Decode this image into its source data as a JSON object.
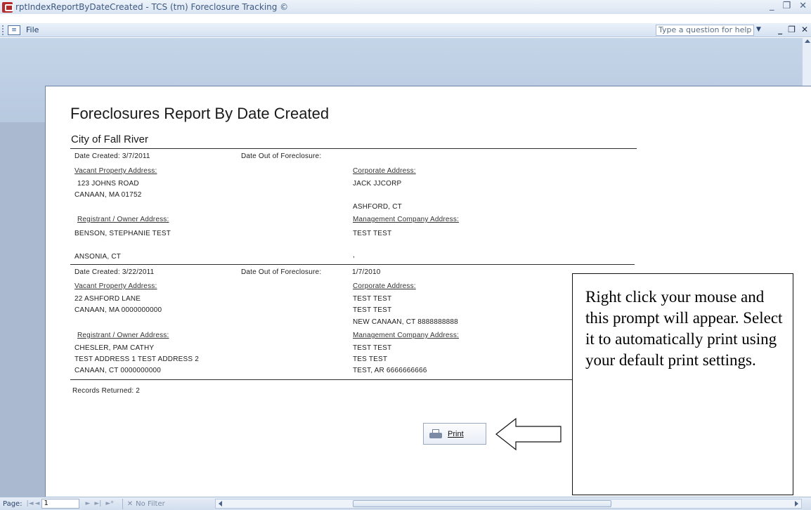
{
  "window": {
    "title": "rptIndexReportByDateCreated - TCS (tm) Foreclosure Tracking ©",
    "min": "_",
    "restore": "❐",
    "close": "✕"
  },
  "menubar": {
    "file": "File",
    "help_placeholder": "Type a question for help",
    "mdi_min": "_",
    "mdi_restore": "❐",
    "mdi_close": "✕"
  },
  "report": {
    "title": "Foreclosures Report By Date Created",
    "city": "City of Fall River",
    "records": [
      {
        "date_created": "Date Created:  3/7/2011",
        "date_out": "Date Out of Foreclosure:",
        "date_out_value": "",
        "vacant_label": "Vacant Property Address:",
        "vacant": [
          "123 JOHNS ROAD",
          "CANAAN, MA 01752"
        ],
        "corporate_label": "Corporate Address:",
        "corporate": [
          "JACK JJCORP",
          "",
          "ASHFORD, CT"
        ],
        "registrant_label": "Registrant / Owner Address:",
        "registrant": [
          "BENSON, STEPHANIE TEST",
          "",
          "ANSONIA, CT"
        ],
        "management_label": "Management Company Address:",
        "management": [
          "TEST TEST",
          "",
          ","
        ]
      },
      {
        "date_created": "Date Created:  3/22/2011",
        "date_out": "Date Out of Foreclosure:",
        "date_out_value": "1/7/2010",
        "vacant_label": "Vacant Property Address:",
        "vacant": [
          "22 ASHFORD LANE",
          "CANAAN, MA 0000000000"
        ],
        "corporate_label": "Corporate Address:",
        "corporate": [
          "TEST TEST",
          "TEST TEST",
          "NEW CANAAN, CT 8888888888"
        ],
        "registrant_label": "Registrant / Owner Address:",
        "registrant": [
          "CHESLER, PAM CATHY",
          "TEST ADDRESS 1 TEST ADDRESS 2",
          "CANAAN, CT 0000000000"
        ],
        "management_label": "Management Company Address:",
        "management": [
          "TEST TEST",
          "TES TEST",
          "TEST, AR 6666666666"
        ]
      }
    ],
    "records_returned": "Records Returned:  2"
  },
  "print_button": {
    "label": "Print"
  },
  "callout": {
    "text": "Right click your mouse and this prompt will appear. Select it to automatically print using your default print settings."
  },
  "statusbar": {
    "page_label": "Page:",
    "page_value": "1",
    "first": "|◄",
    "prev": "◄",
    "next": "►",
    "last": "►|",
    "new": "►*",
    "filter": "No Filter"
  },
  "icons": {
    "app": "access-report-icon",
    "print": "printer-icon",
    "filter": "no-filter-icon",
    "arrow": "left-arrow-icon"
  }
}
